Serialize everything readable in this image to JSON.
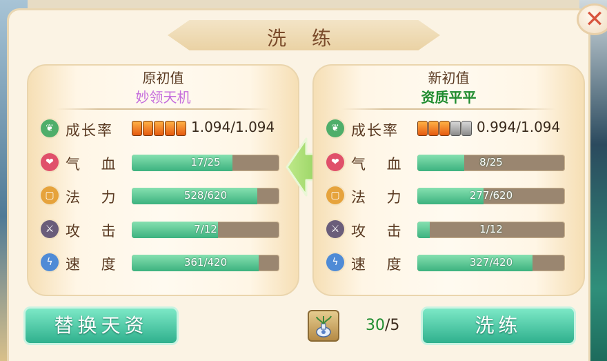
{
  "dialog": {
    "title": "洗 练",
    "close_icon": "close-icon"
  },
  "left_panel": {
    "title": "原初值",
    "subtitle": "妙领天机",
    "growth": {
      "label": "成长率",
      "stars_on": 5,
      "stars_total": 5,
      "text": "1.094/1.094"
    },
    "stats": [
      {
        "label": "气 血",
        "icon": "heart-icon",
        "color": "#e0506a",
        "text": "17/25",
        "value": 17,
        "max": 25
      },
      {
        "label": "法 力",
        "icon": "mana-icon",
        "color": "#e6a33c",
        "text": "528/620",
        "value": 528,
        "max": 620
      },
      {
        "label": "攻 击",
        "icon": "sword-icon",
        "color": "#6a5d7a",
        "text": "7/12",
        "value": 7,
        "max": 12
      },
      {
        "label": "速 度",
        "icon": "speed-icon",
        "color": "#4f8bd6",
        "text": "361/420",
        "value": 361,
        "max": 420
      }
    ]
  },
  "right_panel": {
    "title": "新初值",
    "subtitle": "资质平平",
    "growth": {
      "label": "成长率",
      "stars_on": 3,
      "stars_total": 5,
      "text": "0.994/1.094"
    },
    "stats": [
      {
        "label": "气 血",
        "icon": "heart-icon",
        "color": "#e0506a",
        "text": "8/25",
        "value": 8,
        "max": 25
      },
      {
        "label": "法 力",
        "icon": "mana-icon",
        "color": "#e6a33c",
        "text": "277/620",
        "value": 277,
        "max": 620
      },
      {
        "label": "攻 击",
        "icon": "sword-icon",
        "color": "#6a5d7a",
        "text": "1/12",
        "value": 1,
        "max": 12
      },
      {
        "label": "速 度",
        "icon": "speed-icon",
        "color": "#4f8bd6",
        "text": "327/420",
        "value": 327,
        "max": 420
      }
    ]
  },
  "footer": {
    "replace_label": "替换天资",
    "wash_label": "洗练",
    "item_icon": "potion-vase-icon",
    "count_have": "30",
    "count_sep_need": "/5"
  }
}
